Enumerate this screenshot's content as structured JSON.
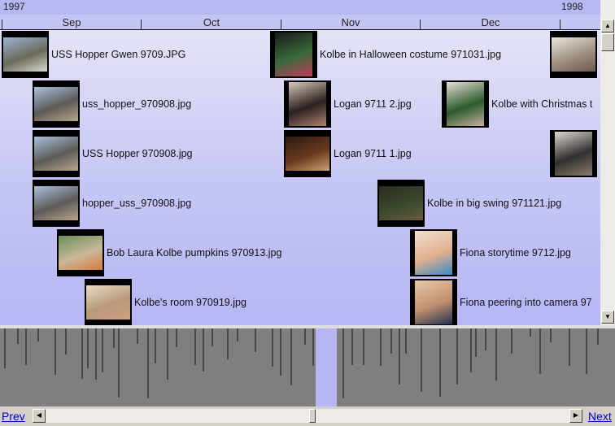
{
  "timeline": {
    "years": [
      "1997",
      "1998"
    ],
    "months": [
      "Sep",
      "Oct",
      "Nov",
      "Dec"
    ]
  },
  "photos": [
    {
      "name": "USS Hopper Gwen 9709.JPG",
      "colors": [
        "#9ab4d4",
        "#6b6a5a",
        "#d8d8d0"
      ]
    },
    {
      "name": "uss_hopper_970908.jpg",
      "colors": [
        "#a8c0dc",
        "#5d5b58",
        "#b8a58c"
      ]
    },
    {
      "name": "USS Hopper 970908.jpg",
      "colors": [
        "#a8c0dc",
        "#5d5b58",
        "#b8a58c"
      ]
    },
    {
      "name": "hopper_uss_970908.jpg",
      "colors": [
        "#a8c0dc",
        "#5d5b58",
        "#b8a58c"
      ]
    },
    {
      "name": "Bob Laura Kolbe pumpkins 970913.jpg",
      "colors": [
        "#6b8e5a",
        "#c8b89a",
        "#d97a3a"
      ]
    },
    {
      "name": "Kolbe's room 970919.jpg",
      "colors": [
        "#e8dcc8",
        "#b89a7a",
        "#d0a080"
      ]
    },
    {
      "name": "Kolbe in Halloween costume 971031.jpg",
      "colors": [
        "#1a1a1a",
        "#3a6a3a",
        "#c03a5a"
      ]
    },
    {
      "name": "Logan 9711 2.jpg",
      "colors": [
        "#d8c8b8",
        "#2a2020",
        "#b08070"
      ]
    },
    {
      "name": "Logan 9711 1.jpg",
      "colors": [
        "#2a1a10",
        "#6a3a20",
        "#d0a070"
      ]
    },
    {
      "name": "Kolbe in big swing 971121.jpg",
      "colors": [
        "#2a2a20",
        "#3a4a2a",
        "#6a5a40"
      ]
    },
    {
      "name": "Kolbe with Christmas t",
      "colors": [
        "#e8e0d8",
        "#2a5a2a",
        "#c8b0a0"
      ]
    },
    {
      "name": "Fiona storytime 9712.jpg",
      "colors": [
        "#f0e0d0",
        "#e0b090",
        "#3a8ac0"
      ]
    },
    {
      "name": "Fiona peering into camera 97",
      "colors": [
        "#e8c8a8",
        "#c09070",
        "#203050"
      ]
    },
    {
      "name": "",
      "colors": [
        "#e8e8e0",
        "#a09080",
        "#6a5a50"
      ]
    },
    {
      "name": "",
      "colors": [
        "#e0d8d0",
        "#303030",
        "#8a7a6a"
      ]
    }
  ],
  "scrollbar": {
    "up_arrow": "triangle-up",
    "down_arrow": "triangle-down",
    "left_arrow": "triangle-left",
    "right_arrow": "triangle-right"
  },
  "nav": {
    "prev_label": "Prev",
    "next_label": "Next"
  }
}
